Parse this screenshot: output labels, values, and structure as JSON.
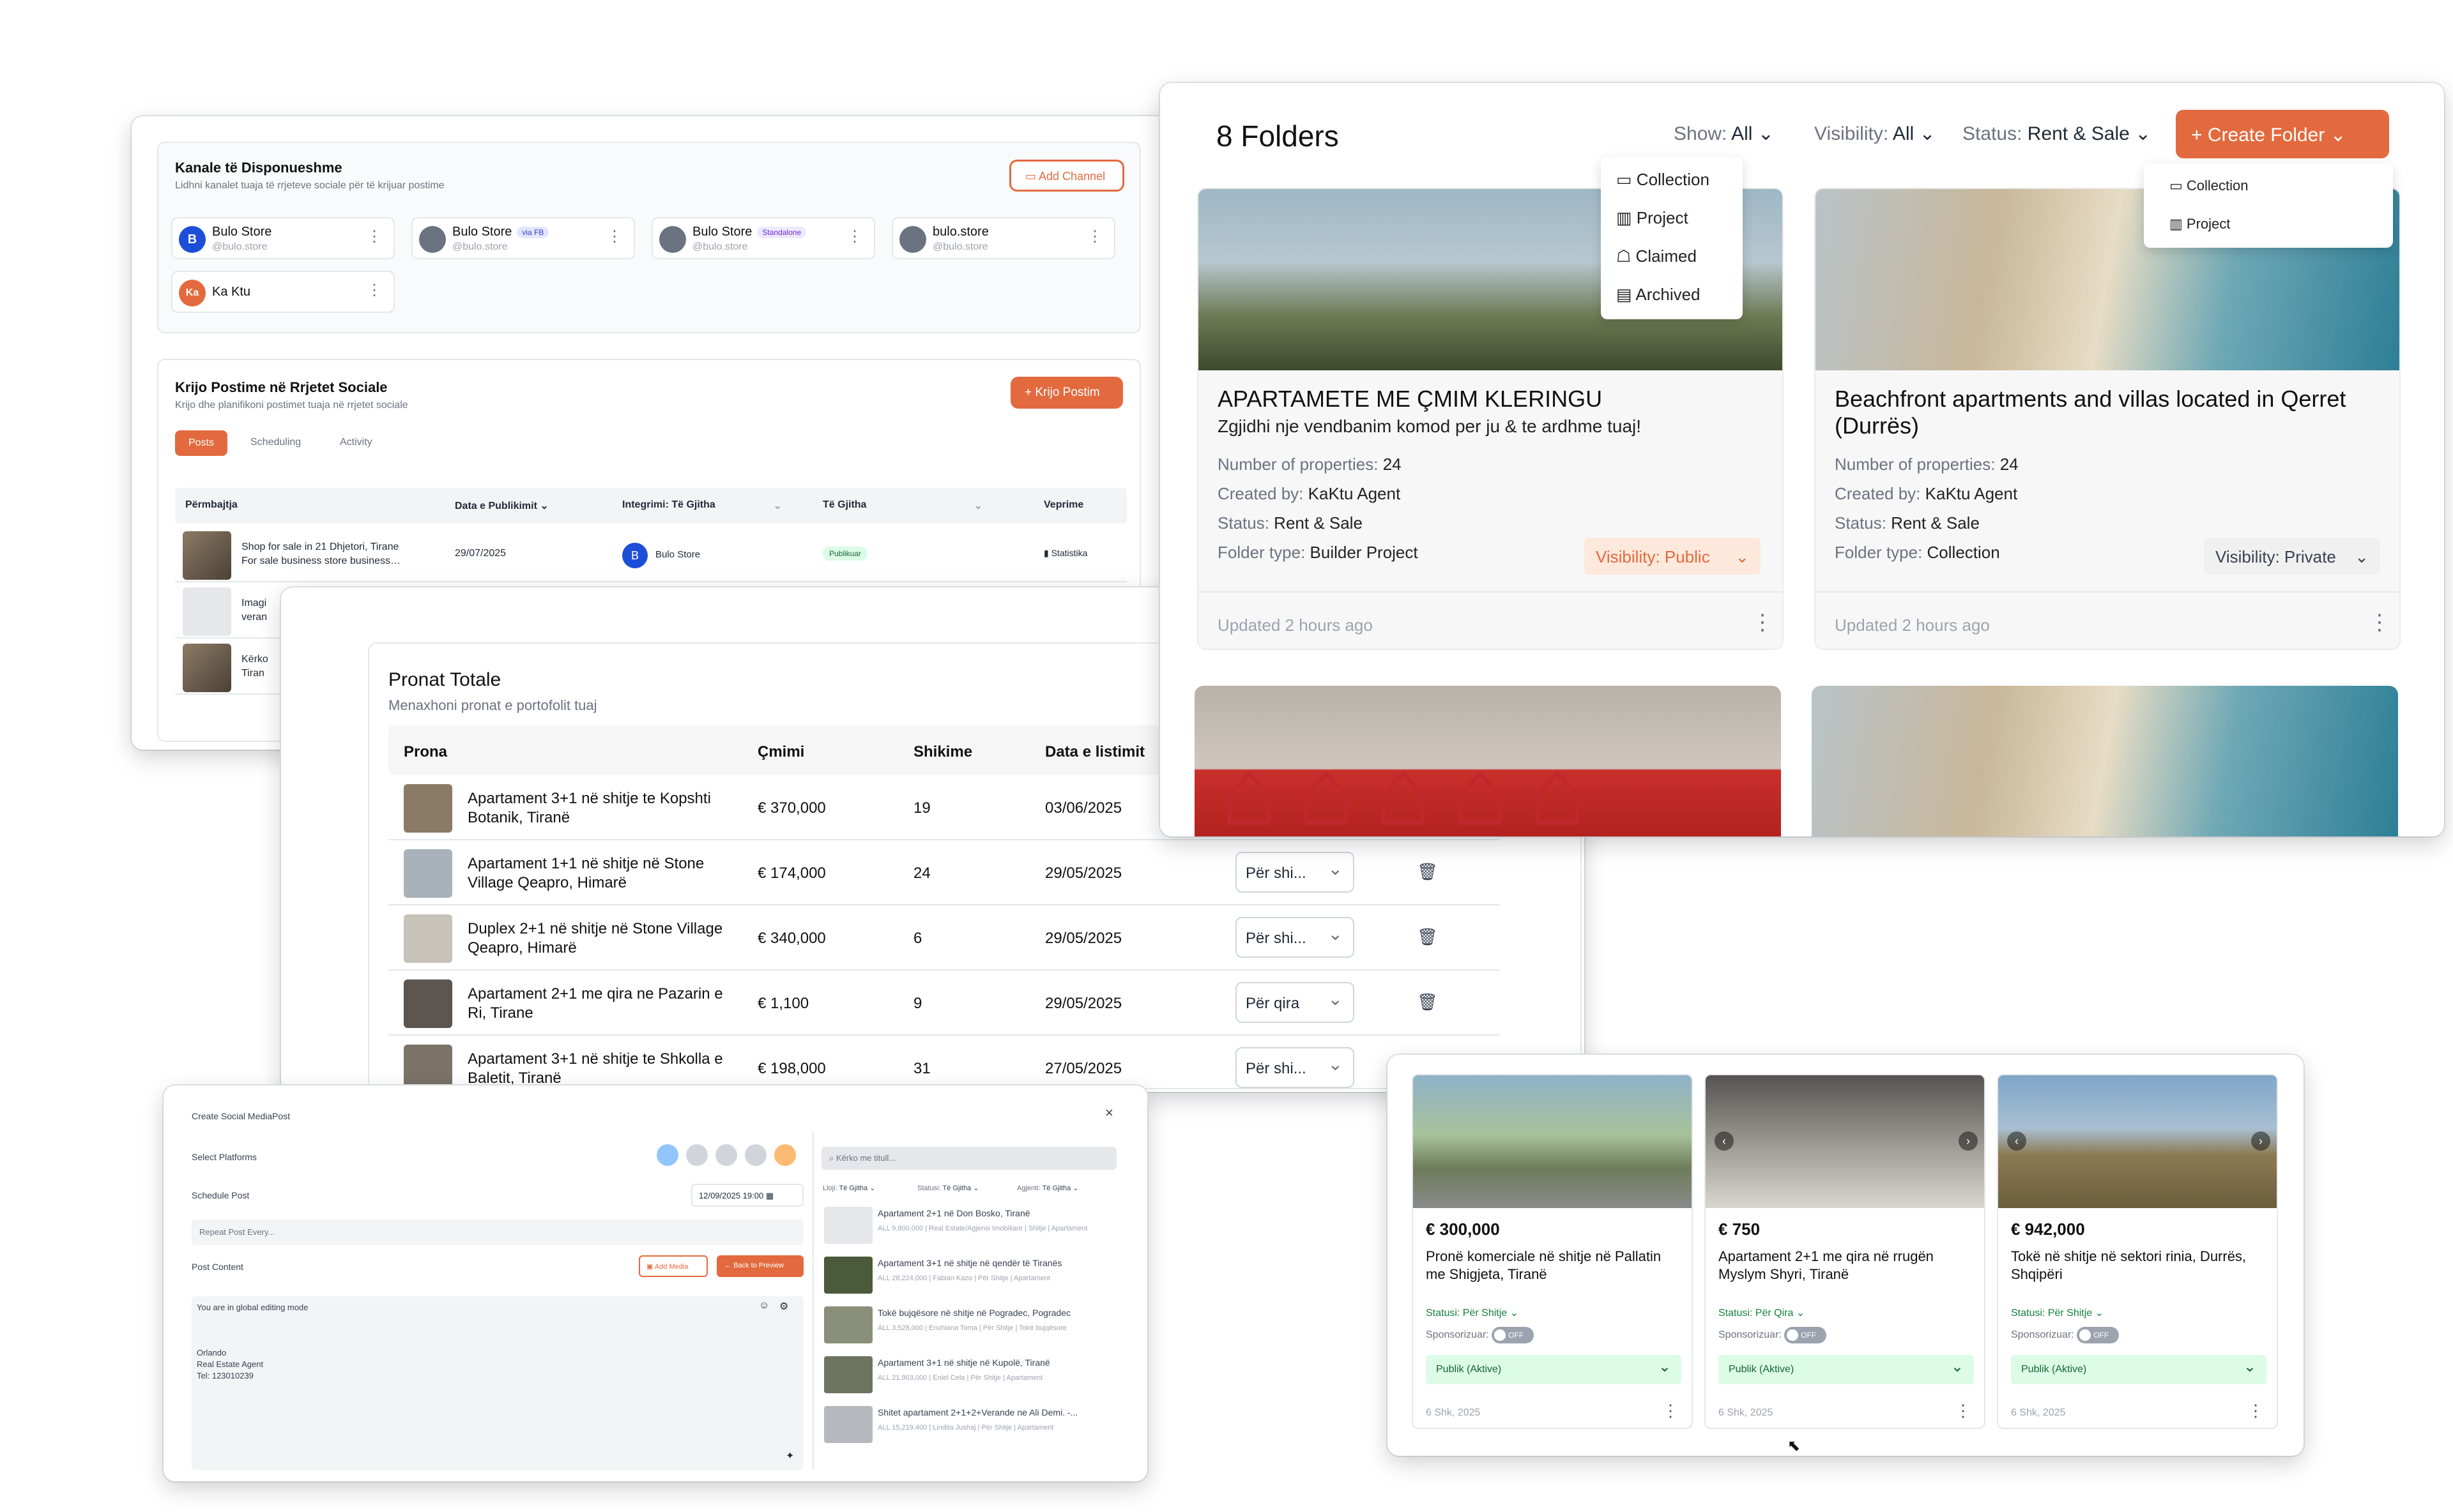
{
  "channels_panel": {
    "title": "Kanale të Disponueshme",
    "subtitle": "Lidhni kanalet tuaja të rrjeteve sociale për të krijuar postime",
    "add_button": "Add Channel",
    "channels": [
      {
        "avatar": "B",
        "name": "Bulo Store",
        "handle": "@bulo.store",
        "tag": ""
      },
      {
        "avatar": "",
        "name": "Bulo Store",
        "handle": "@bulo.store",
        "tag": "via FB"
      },
      {
        "avatar": "",
        "name": "Bulo Store",
        "handle": "@bulo.store",
        "tag": "Standalone"
      },
      {
        "avatar": "",
        "name": "bulo.store",
        "handle": "@bulo.store",
        "tag": ""
      },
      {
        "avatar": "Ka",
        "name": "Ka Ktu",
        "handle": "",
        "tag": ""
      }
    ]
  },
  "posts_panel": {
    "title": "Krijo Postime në Rrjetet Sociale",
    "subtitle": "Krijo dhe planifikoni postimet tuaja në rrjetet sociale",
    "create_button": "Krijo Postim",
    "tabs": [
      "Posts",
      "Scheduling",
      "Activity"
    ],
    "columns": [
      "Përmbajtja",
      "Data e Publikimit",
      "Integrimi: Të Gjitha",
      "Të Gjitha",
      "Veprime"
    ],
    "rows": [
      {
        "content": "Shop for sale in 21 Dhjetori, Tirane\nFor sale business store business…",
        "date": "29/07/2025",
        "integration": "Bulo Store",
        "status": "Publikuar",
        "action": "Statistika"
      },
      {
        "content": "Imagi\nveran",
        "date": "",
        "integration": "",
        "status": "",
        "action": ""
      },
      {
        "content": "Kërko\nTiran",
        "date": "",
        "integration": "",
        "status": "",
        "action": ""
      }
    ]
  },
  "properties": {
    "title": "Pronat Totale",
    "subtitle": "Menaxhoni pronat e portofolit tuaj",
    "columns": [
      "Prona",
      "Çmimi",
      "Shikime",
      "Data e listimit"
    ],
    "rows": [
      {
        "name": "Apartament 3+1 në shitje te Kopshti Botanik, Tiranë",
        "price": "€ 370,000",
        "views": "19",
        "date": "03/06/2025",
        "type": ""
      },
      {
        "name": "Apartament 1+1 në shitje në Stone Village Qeapro, Himarë",
        "price": "€ 174,000",
        "views": "24",
        "date": "29/05/2025",
        "type": "Për shi..."
      },
      {
        "name": "Duplex 2+1 në shitje në Stone Village Qeapro, Himarë",
        "price": "€ 340,000",
        "views": "6",
        "date": "29/05/2025",
        "type": "Për shi..."
      },
      {
        "name": "Apartament 2+1 me qira ne Pazarin e Ri, Tirane",
        "price": "€ 1,100",
        "views": "9",
        "date": "29/05/2025",
        "type": "Për qira"
      },
      {
        "name": "Apartament 3+1 në shitje te Shkolla e Baletit, Tiranë",
        "price": "€ 198,000",
        "views": "31",
        "date": "27/05/2025",
        "type": "Për shi..."
      }
    ]
  },
  "folders": {
    "title": "8 Folders",
    "filters": [
      {
        "label": "Show:",
        "value": "All"
      },
      {
        "label": "Visibility:",
        "value": "All"
      },
      {
        "label": "Status:",
        "value": "Rent & Sale"
      }
    ],
    "create_button": "Create Folder",
    "show_menu": [
      "Collection",
      "Project",
      "Claimed",
      "Archived"
    ],
    "create_menu": [
      "Collection",
      "Project"
    ],
    "cards": [
      {
        "title": "APARTAMETE ME ÇMIM KLERINGU",
        "subtitle": "Zgjidhi nje vendbanim komod per ju & te ardhme tuaj!",
        "count_label": "Number of properties:",
        "count": "24",
        "creator_label": "Created by:",
        "creator": "KaKtu Agent",
        "status_label": "Status:",
        "status": "Rent & Sale",
        "type_label": "Folder type:",
        "type": "Builder Project",
        "visibility": "Visibility: Public",
        "updated": "Updated 2 hours ago"
      },
      {
        "title": "Beachfront apartments and villas located in Qerret (Durrës)",
        "subtitle": "",
        "count_label": "Number of properties:",
        "count": "24",
        "creator_label": "Created by:",
        "creator": "KaKtu Agent",
        "status_label": "Status:",
        "status": "Rent & Sale",
        "type_label": "Folder type:",
        "type": "Collection",
        "visibility": "Visibility: Private",
        "updated": "Updated 2 hours ago"
      }
    ],
    "colors": {
      "accent": "#e36a3e",
      "public_bg": "#fde8dc",
      "private_bg": "#f0f0f0"
    }
  },
  "listings": [
    {
      "price": "€ 300,000",
      "title": "Pronë komerciale në shitje në Pallatin me Shigjeta, Tiranë",
      "status": "Statusi: Për Shitje",
      "sponsor": "Sponsorizuar:",
      "toggle": "OFF",
      "publish": "Publik (Aktive)",
      "date": "6 Shk, 2025"
    },
    {
      "price": "€ 750",
      "title": "Apartament 2+1 me qira në rrugën Myslym Shyri, Tiranë",
      "status": "Statusi: Për Qira",
      "sponsor": "Sponsorizuar:",
      "toggle": "OFF",
      "publish": "Publik (Aktive)",
      "date": "6 Shk, 2025"
    },
    {
      "price": "€ 942,000",
      "title": "Tokë në shitje në sektori rinia, Durrës, Shqipëri",
      "status": "Statusi: Për Shitje",
      "sponsor": "Sponsorizuar:",
      "toggle": "OFF",
      "publish": "Publik (Aktive)",
      "date": "6 Shk, 2025"
    }
  ],
  "social_modal": {
    "title": "Create Social MediaPost",
    "platforms_label": "Select Platforms",
    "schedule_label": "Schedule Post",
    "schedule_value": "12/09/2025 19:00",
    "repeat_placeholder": "Repeat Post Every...",
    "content_label": "Post Content",
    "add_media": "Add Media",
    "back_preview": "Back to Preview",
    "mode_note": "You are in global editing mode",
    "body": "Orlando\nReal Estate Agent\nTel: 123010239",
    "search_placeholder": "Kërko me titull...",
    "filters": [
      {
        "label": "Lloji:",
        "value": "Të Gjitha"
      },
      {
        "label": "Statusi:",
        "value": "Të Gjitha"
      },
      {
        "label": "Agjenti:",
        "value": "Të Gjitha"
      }
    ],
    "results": [
      {
        "title": "Apartament 2+1 në Don Bosko, Tiranë",
        "sub": "ALL 9,800,000 | Real Estate/Agjensi Imobiliare | Shitje | Apartament"
      },
      {
        "title": "Apartament 3+1 në shitje në qendër të Tiranës",
        "sub": "ALL 28,224,000 | Fabian Kazo | Për Shitje | Apartament"
      },
      {
        "title": "Tokë bujqësore në shitje në Pogradec, Pogradec",
        "sub": "ALL 3,528,000 | Enxhiana Toma | Për Shitje | Tokë bujqësore"
      },
      {
        "title": "Apartament 3+1 në shitje në Kupolë, Tiranë",
        "sub": "ALL 21,903,000 | Eniel Cela | Për Shitje | Apartament"
      },
      {
        "title": "Shitet apartament 2+1+2+Verande ne Ali Demi. -...",
        "sub": "ALL 15,219,400 | Lindita Jushaj | Për Shitje | Apartament"
      }
    ]
  }
}
